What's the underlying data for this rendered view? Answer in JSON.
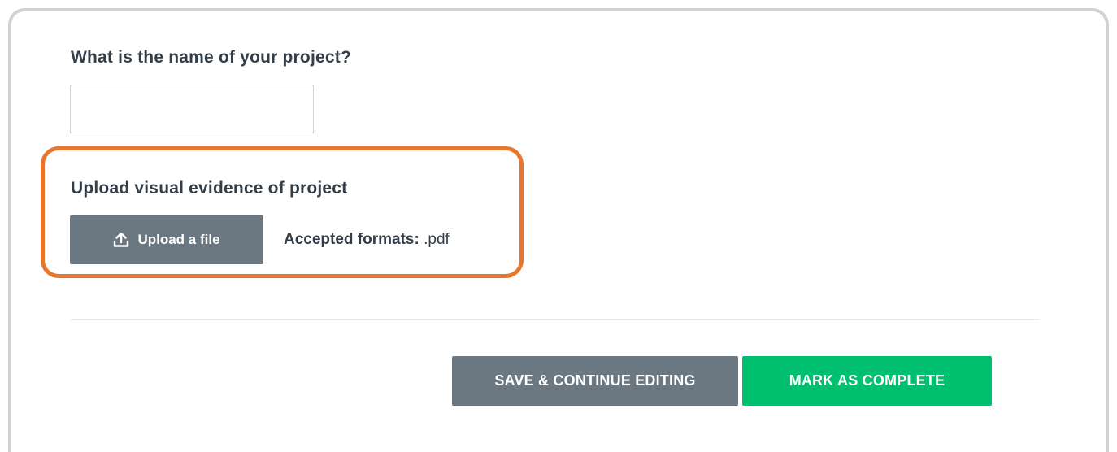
{
  "form": {
    "project_name": {
      "label": "What is the name of your project?",
      "value": ""
    },
    "upload": {
      "label": "Upload visual evidence of project",
      "button_label": "Upload a file",
      "button_icon": "upload-icon",
      "formats_label": "Accepted formats:",
      "formats_value": ".pdf"
    }
  },
  "actions": {
    "save_label": "SAVE & CONTINUE EDITING",
    "complete_label": "MARK AS COMPLETE"
  },
  "colors": {
    "highlight": "#e8762c",
    "secondary_button": "#6b7882",
    "primary_button": "#00bf6f",
    "text": "#333e48"
  }
}
